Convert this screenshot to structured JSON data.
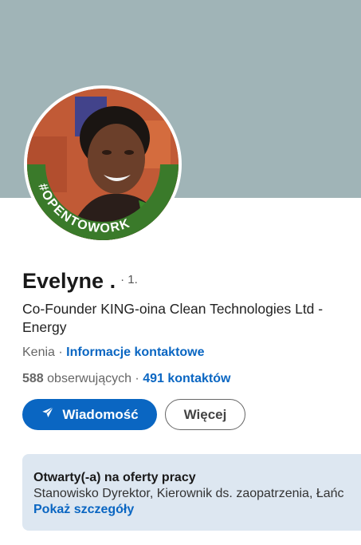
{
  "profile": {
    "name": "Evelyne .",
    "degree": "· 1.",
    "headline_line1": "Co-Founder KING-oina Clean Technologies Ltd -",
    "headline_line2": "Energy",
    "location": "Kenia",
    "separator": " · ",
    "contact_info_link": "Informacje kontaktowe",
    "followers_count": "588",
    "followers_label": "obserwujących",
    "stats_separator": " · ",
    "connections_link": "491 kontaktów",
    "avatar_badge_text": "#OPENTOWORK"
  },
  "actions": {
    "message_label": "Wiadomość",
    "more_label": "Więcej"
  },
  "open_to_work": {
    "title": "Otwarty(-a) na oferty pracy",
    "description": "Stanowisko Dyrektor, Kierownik ds. zaopatrzenia, Łańc",
    "details_link": "Pokaż szczegóły"
  },
  "colors": {
    "cover": "#a0b4b7",
    "primary": "#0a66c2",
    "open_to_work_ring": "#3a7a2a",
    "card_bg": "#dde7f1"
  }
}
